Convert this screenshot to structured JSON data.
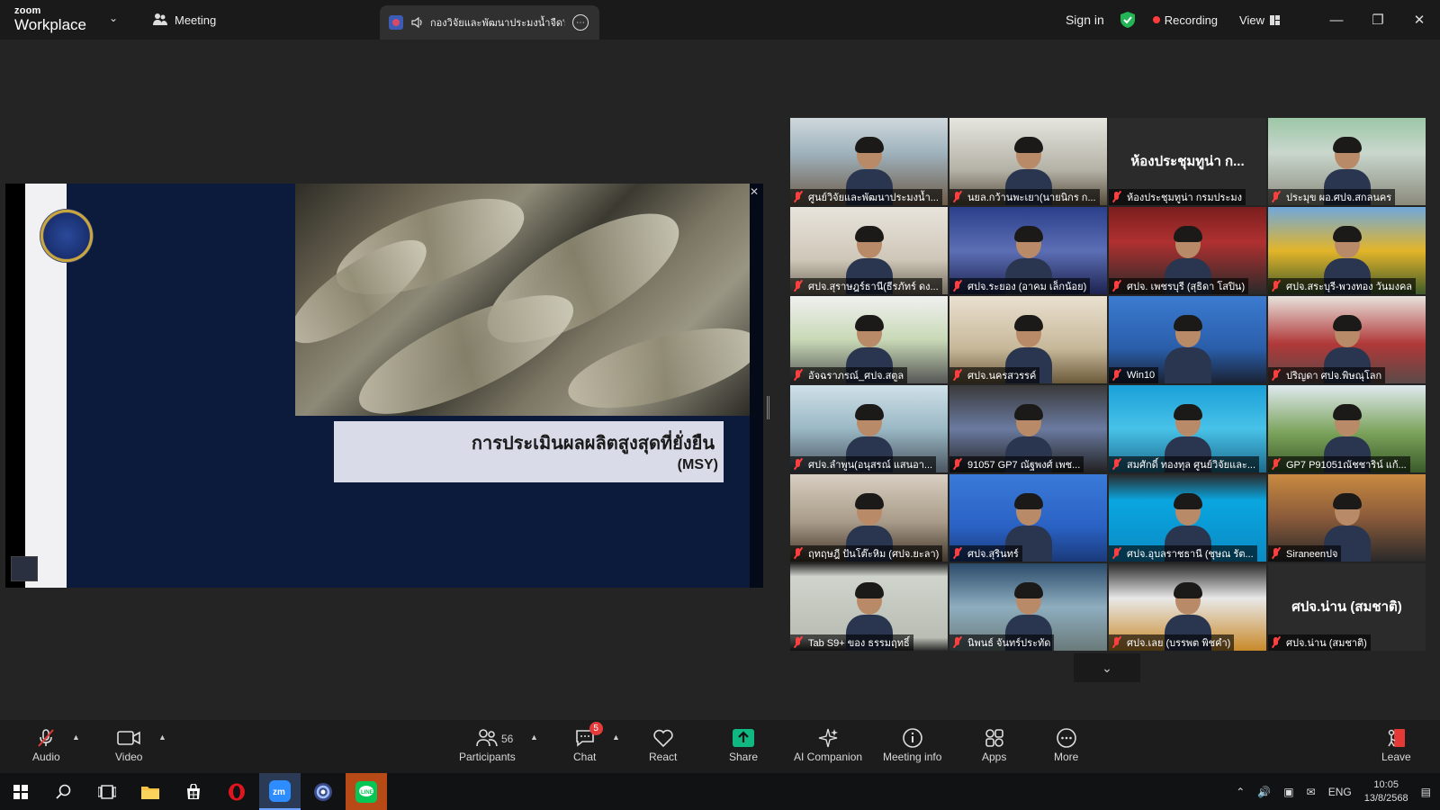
{
  "titlebar": {
    "brand_small": "zoom",
    "brand_big": "Workplace",
    "meeting_label": "Meeting",
    "tab_title": "กองวิจัยและพัฒนาประมงน้ำจืด's s",
    "signin": "Sign in",
    "recording": "Recording",
    "view": "View"
  },
  "slide": {
    "title": "การประเมินผลผลิตสูงสุดที่ยั่งยืน",
    "subtitle": "(MSY)"
  },
  "participants": [
    {
      "name": "ศูนย์วิจัยและพัฒนาประมงน้ำ..."
    },
    {
      "name": "นยล.กว้านพะเยา(นายนิกร ก..."
    },
    {
      "name": "ห้องประชุมทูน่า กรมประมง",
      "label": "ห้องประชุมทูน่า ก...",
      "active": true
    },
    {
      "name": "ประมุข ผอ.ศปจ.สกลนคร"
    },
    {
      "name": "ศปจ.สุราษฎร์ธานี(ธีรภัทร์ ดง..."
    },
    {
      "name": "ศปจ.ระยอง (อาคม เล็กน้อย)"
    },
    {
      "name": "ศปจ. เพชรบุรี (สุธิดา โสปิน)"
    },
    {
      "name": "ศปจ.สระบุรี-พวงทอง วันมงคล"
    },
    {
      "name": "อัจฉราภรณ์_ศปจ.สตูล"
    },
    {
      "name": "ศปจ.นครสวรรค์"
    },
    {
      "name": "Win10"
    },
    {
      "name": "ปริญดา ศปจ.พิษณุโลก"
    },
    {
      "name": "ศปจ.ลำพูน(อนุสรณ์ แสนอา..."
    },
    {
      "name": "91057 GP7 ณัฐพงศ์ เพช..."
    },
    {
      "name": "สมศักดิ์ ทองทุล ศูนย์วิจัยและ..."
    },
    {
      "name": "GP7 P91051ณัชชาริน์ แก้..."
    },
    {
      "name": "ฤทฤษฎี ปันโต๊ะหิม (ศปจ.ยะลา)"
    },
    {
      "name": "ศปจ.สุรินทร์"
    },
    {
      "name": "ศปจ.อุบลราชธานี (ชุษณ รัต..."
    },
    {
      "name": "Siraneenปจ"
    },
    {
      "name": "Tab S9+ ของ ธรรมฤทธิ์"
    },
    {
      "name": "นิพนธ์ จันทร์ประทัด"
    },
    {
      "name": "ศปจ.เลย (บรรพต พิชคำ)"
    },
    {
      "name": "ศปจ.น่าน (สมชาติ)",
      "label": "ศปจ.น่าน (สมชาติ)"
    }
  ],
  "toolbar": {
    "audio": "Audio",
    "video": "Video",
    "participants": "Participants",
    "participants_count": "56",
    "chat": "Chat",
    "chat_badge": "5",
    "react": "React",
    "share": "Share",
    "ai_companion": "AI Companion",
    "meeting_info": "Meeting info",
    "apps": "Apps",
    "more": "More",
    "leave": "Leave"
  },
  "taskbar": {
    "lang": "ENG",
    "time": "10:05",
    "date": "13/8/2568"
  },
  "colors": {
    "share_accent": "#10b981",
    "active_tile": "#2ed46f",
    "recording_dot": "#ff3b3b"
  }
}
